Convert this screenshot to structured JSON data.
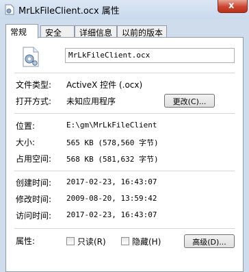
{
  "window": {
    "title": "MrLkFileClient.ocx 属性",
    "close_label": "x"
  },
  "tabs": [
    {
      "label": "常规"
    },
    {
      "label": "安全"
    },
    {
      "label": "详细信息"
    },
    {
      "label": "以前的版本"
    }
  ],
  "file": {
    "name": "MrLkFileClient.ocx"
  },
  "props": {
    "type_label": "文件类型:",
    "type_value": "ActiveX 控件 (.ocx)",
    "open_label": "打开方式:",
    "open_value": "未知应用程序",
    "change_button": "更改(C)...",
    "location_label": "位置:",
    "location_value": "E:\\gm\\MrLkFileClient",
    "size_label": "大小:",
    "size_value": "565 KB (578,560 字节)",
    "disk_label": "占用空间:",
    "disk_value": "568 KB (581,632 字节)",
    "created_label": "创建时间:",
    "created_value": "2017-02-23, 16:43:07",
    "modified_label": "修改时间:",
    "modified_value": "2009-08-20, 13:59:42",
    "accessed_label": "访问时间:",
    "accessed_value": "2017-02-23, 16:43:07",
    "attr_label": "属性:",
    "readonly_label": "只读(R)",
    "hidden_label": "隐藏(H)",
    "advanced_button": "高级(D)..."
  }
}
